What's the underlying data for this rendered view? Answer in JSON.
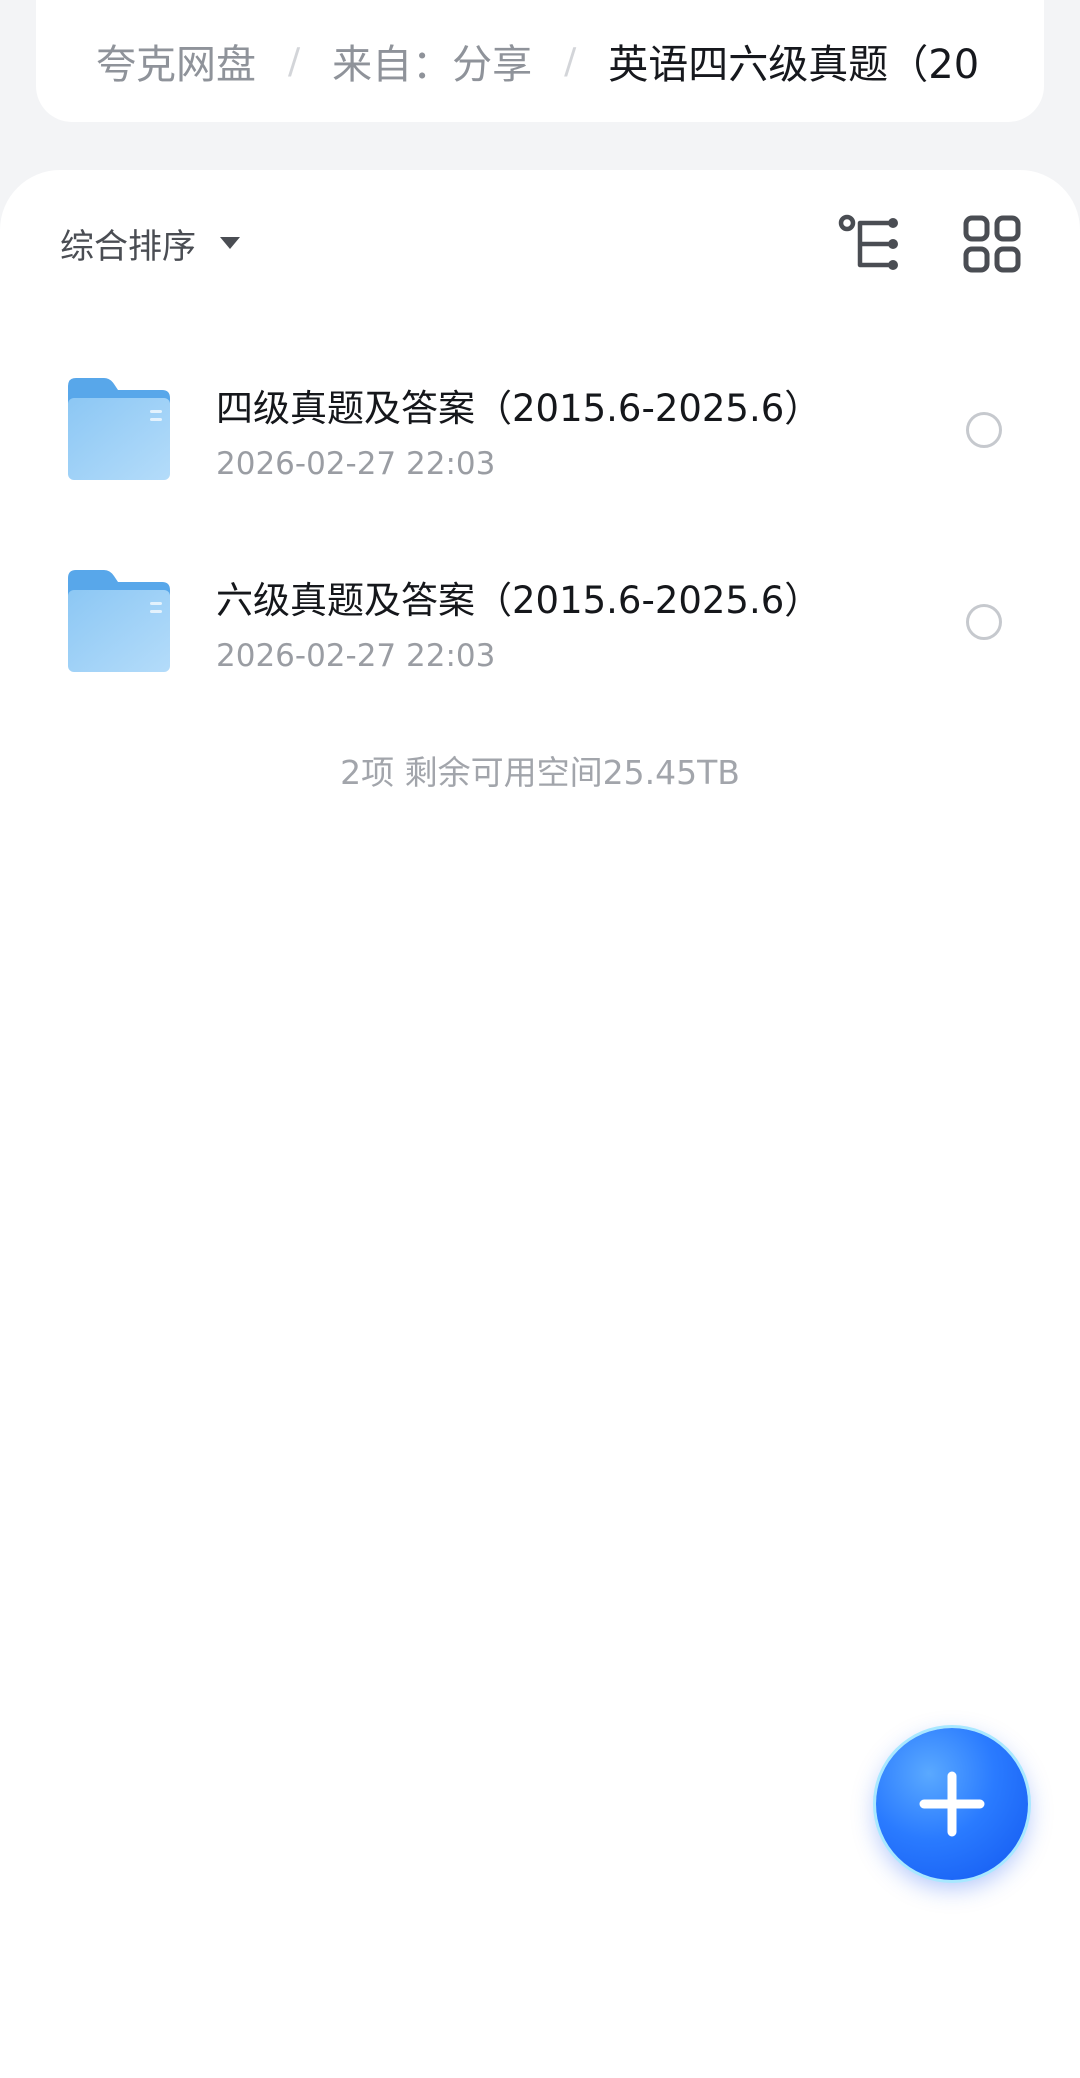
{
  "breadcrumb": {
    "items": [
      "夸克网盘",
      "来自：分享"
    ],
    "current": "英语四六级真题（20",
    "separator": "/"
  },
  "toolbar": {
    "sort_label": "综合排序",
    "sort_icon": "caret-down-icon",
    "tree_icon": "tree-view-icon",
    "grid_icon": "grid-view-icon"
  },
  "files": [
    {
      "name": "四级真题及答案（2015.6-2025.6）",
      "date": "2026-02-27 22:03",
      "type": "folder",
      "selected": false
    },
    {
      "name": "六级真题及答案（2015.6-2025.6）",
      "date": "2026-02-27 22:03",
      "type": "folder",
      "selected": false
    }
  ],
  "footer": {
    "storage_info": "2项 剩余可用空间25.45TB"
  },
  "fab": {
    "icon": "plus-icon"
  },
  "colors": {
    "accent": "#2a7bff",
    "folder": "#7fc0f2",
    "text_primary": "#15171b",
    "text_secondary": "#9a9da3"
  }
}
